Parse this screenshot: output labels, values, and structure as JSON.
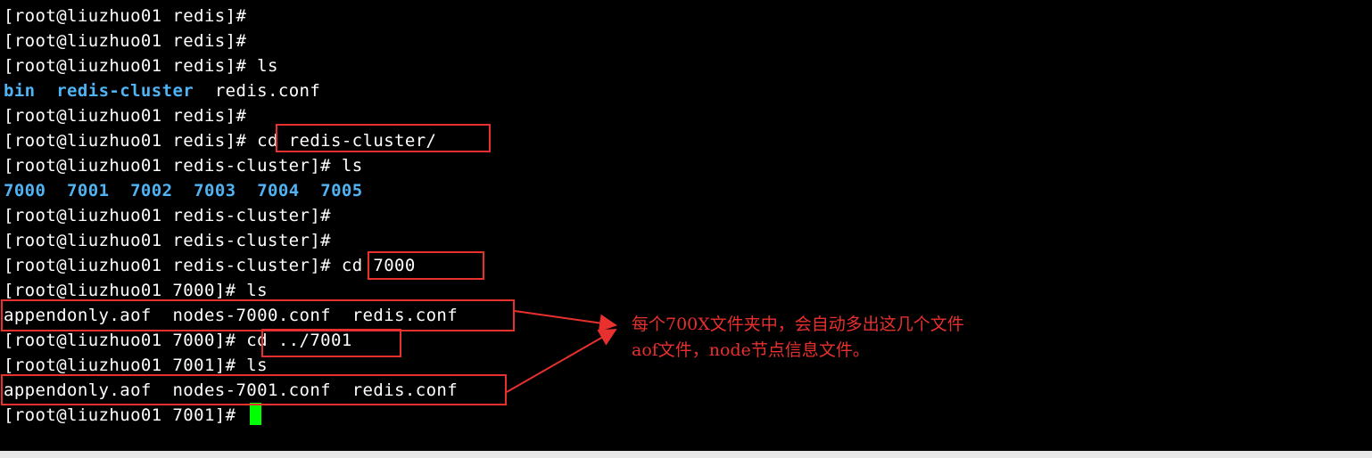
{
  "terminal": {
    "lines": [
      {
        "prompt": "[root@liuzhuo01 redis]#",
        "command": ""
      },
      {
        "prompt": "[root@liuzhuo01 redis]#",
        "command": ""
      },
      {
        "prompt": "[root@liuzhuo01 redis]#",
        "command": " ls"
      },
      {
        "output_dirs": [
          "bin",
          "redis-cluster"
        ],
        "output_files": [
          "redis.conf"
        ]
      },
      {
        "prompt": "[root@liuzhuo01 redis]#",
        "command": ""
      },
      {
        "prompt": "[root@liuzhuo01 redis]#",
        "command": " cd redis-cluster/"
      },
      {
        "prompt": "[root@liuzhuo01 redis-cluster]#",
        "command": " ls"
      },
      {
        "output_dirs": [
          "7000",
          "7001",
          "7002",
          "7003",
          "7004",
          "7005"
        ]
      },
      {
        "prompt": "[root@liuzhuo01 redis-cluster]#",
        "command": ""
      },
      {
        "prompt": "[root@liuzhuo01 redis-cluster]#",
        "command": ""
      },
      {
        "prompt": "[root@liuzhuo01 redis-cluster]#",
        "command": " cd 7000"
      },
      {
        "prompt": "[root@liuzhuo01 7000]#",
        "command": " ls"
      },
      {
        "output_files": [
          "appendonly.aof",
          "nodes-7000.conf",
          "redis.conf"
        ]
      },
      {
        "prompt": "[root@liuzhuo01 7000]#",
        "command": " cd ../7001"
      },
      {
        "prompt": "[root@liuzhuo01 7001]#",
        "command": " ls"
      },
      {
        "output_files": [
          "appendonly.aof",
          "nodes-7001.conf",
          "redis.conf"
        ]
      },
      {
        "prompt": "[root@liuzhuo01 7001]#",
        "command": " "
      }
    ],
    "colors": {
      "background": "#000000",
      "text": "#ffffff",
      "directory": "#4fb3f4",
      "cursor": "#00ff00"
    }
  },
  "annotation": {
    "line1": "每个700X文件夹中，会自动多出这几个文件",
    "line2": "aof文件，node节点信息文件。",
    "color": "#e8302e"
  }
}
